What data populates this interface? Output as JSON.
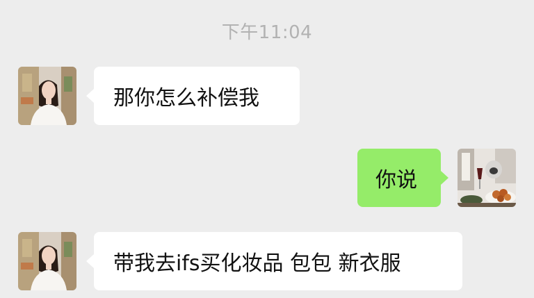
{
  "timestamp": "下午11:04",
  "messages": [
    {
      "sender": "contact",
      "text": "那你怎么补偿我"
    },
    {
      "sender": "me",
      "text": "你说"
    },
    {
      "sender": "contact",
      "text": "带我去ifs买化妆品 包包 新衣服"
    }
  ],
  "colors": {
    "background": "#ededed",
    "incoming_bubble": "#ffffff",
    "outgoing_bubble": "#95ec69",
    "timestamp_text": "#b2b2b2"
  }
}
